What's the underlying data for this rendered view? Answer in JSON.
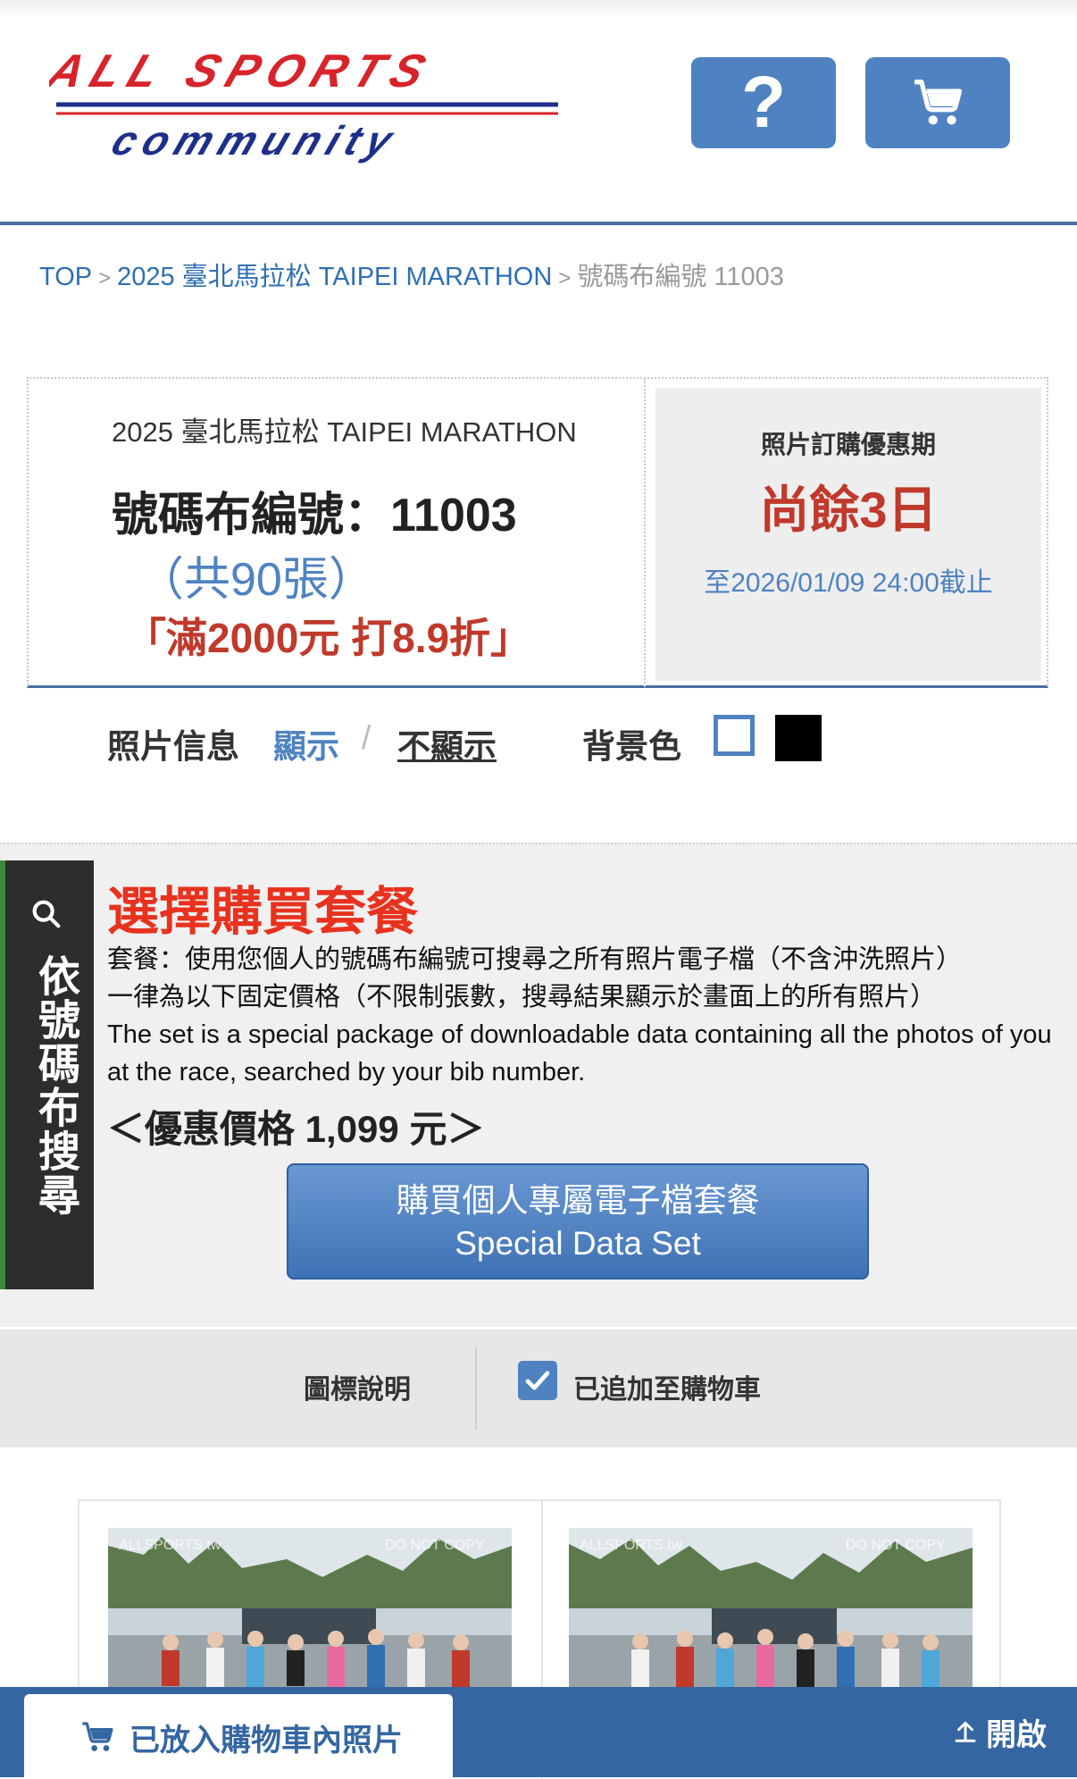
{
  "header": {
    "logo_line1": "ALL SPORTS",
    "logo_line2": "community",
    "help_icon": "question-mark-icon",
    "help_glyph": "?",
    "cart_icon": "shopping-cart-icon"
  },
  "breadcrumb": {
    "top": "TOP",
    "event": "2025 臺北馬拉松 TAIPEI MARATHON",
    "current": "號碼布編號 11003",
    "separator": ">"
  },
  "info": {
    "event_title": "2025 臺北馬拉松 TAIPEI MARATHON",
    "bib_label": "號碼布編號：11003",
    "photo_count": "（共90張）",
    "promo": "「滿2000元 打8.9折」",
    "deadline_title": "照片訂購優惠期",
    "deadline_remaining": "尚餘3日",
    "deadline_date": "至2026/01/09 24:00截止"
  },
  "options": {
    "photo_info_label": "照片信息",
    "show": "顯示",
    "slash": "/",
    "hide": "不顯示",
    "bg_label": "背景色"
  },
  "package": {
    "side_tab": "依號碼布搜尋",
    "side_icon": "search-icon",
    "title": "選擇購買套餐",
    "desc_line1": "套餐：使用您個人的號碼布編號可搜尋之所有照片電子檔（不含沖洗照片）",
    "desc_line2": "一律為以下固定價格（不限制張數，搜尋結果顯示於畫面上的所有照片）",
    "desc_line3": "The set is a special package of downloadable data containing all the photos of you at the race, searched by your bib number.",
    "price": "＜優惠價格 1,099 元＞",
    "buy_line1": "購買個人專屬電子檔套餐",
    "buy_line2": "Special Data Set"
  },
  "legend": {
    "label": "圖標說明",
    "check_icon": "checkbox-checked-icon",
    "added_text": "已追加至購物車"
  },
  "photos": [
    {
      "watermark_left": "ALLSPORTS.tw",
      "watermark_right": "DO NOT COPY"
    },
    {
      "watermark_left": "ALLSPORTS.tw",
      "watermark_right": "DO NOT COPY"
    }
  ],
  "bottom_bar": {
    "tab_icon": "cart-icon",
    "tab_label": "已放入購物車內照片",
    "open_icon": "arrow-up-icon",
    "open_label": "開啟"
  },
  "colors": {
    "accent_blue": "#4f82c1",
    "header_line": "#4a6f9f",
    "promo_red": "#c0392b",
    "title_red": "#e8321e",
    "bottom_bar": "#3466a1"
  }
}
